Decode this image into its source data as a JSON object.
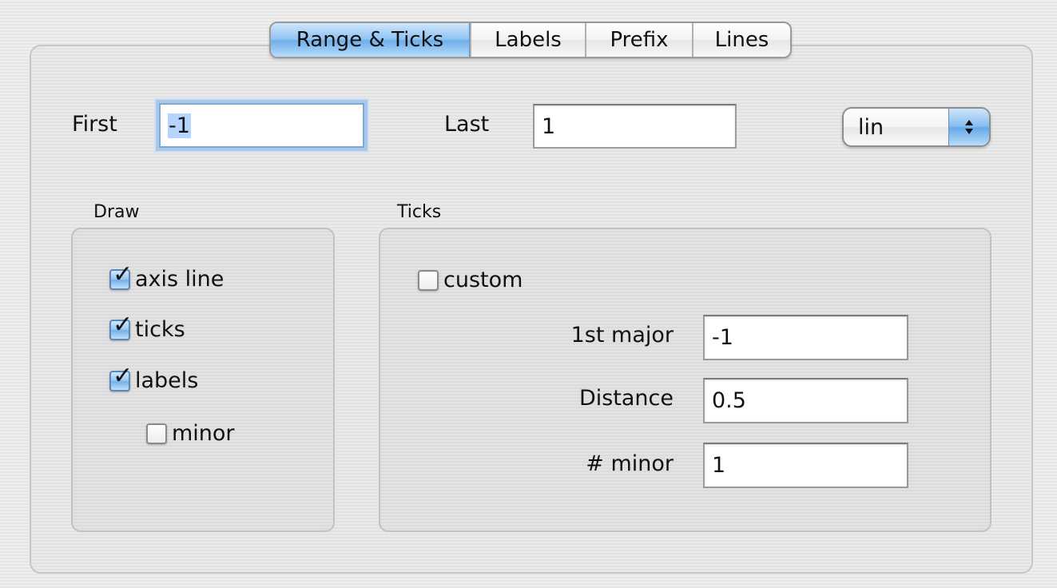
{
  "tabs": [
    {
      "label": "Range & Ticks",
      "active": true
    },
    {
      "label": "Labels",
      "active": false
    },
    {
      "label": "Prefix",
      "active": false
    },
    {
      "label": "Lines",
      "active": false
    }
  ],
  "range": {
    "first_label": "First",
    "first_value": "-1",
    "last_label": "Last",
    "last_value": "1",
    "scale_value": "lin"
  },
  "draw": {
    "title": "Draw",
    "axis_line": {
      "label": "axis line",
      "checked": true
    },
    "ticks": {
      "label": "ticks",
      "checked": true
    },
    "labels": {
      "label": "labels",
      "checked": true
    },
    "minor": {
      "label": "minor",
      "checked": false
    }
  },
  "ticks_group": {
    "title": "Ticks",
    "custom": {
      "label": "custom",
      "checked": false
    },
    "first_major_label": "1st major",
    "first_major_value": "-1",
    "distance_label": "Distance",
    "distance_value": "0.5",
    "num_minor_label": "# minor",
    "num_minor_value": "1"
  },
  "colors": {
    "accent": "#6eaeea",
    "focus_ring": "#a9c9ea",
    "selection": "#b5d5ff"
  }
}
